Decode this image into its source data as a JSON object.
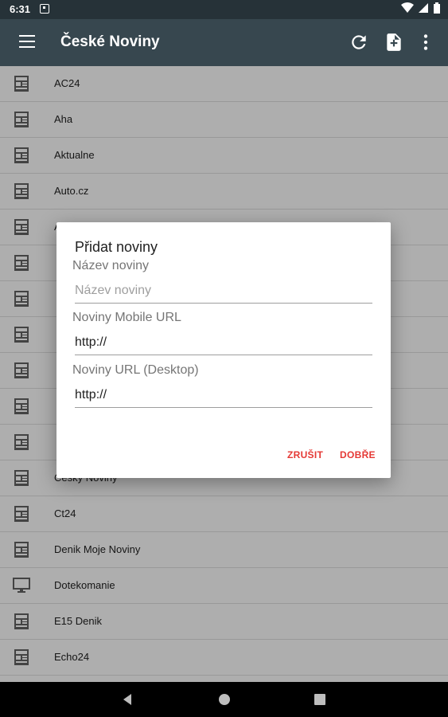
{
  "status_bar": {
    "time": "6:31"
  },
  "app_bar": {
    "title": "České Noviny"
  },
  "list_items": [
    {
      "label": "AC24",
      "icon": "newspaper-icon"
    },
    {
      "label": "Aha",
      "icon": "newspaper-icon"
    },
    {
      "label": "Aktualne",
      "icon": "newspaper-icon"
    },
    {
      "label": "Auto.cz",
      "icon": "newspaper-icon"
    },
    {
      "label": "A",
      "icon": "newspaper-icon"
    },
    {
      "label": "",
      "icon": "newspaper-icon"
    },
    {
      "label": "",
      "icon": "newspaper-icon"
    },
    {
      "label": "",
      "icon": "newspaper-icon"
    },
    {
      "label": "",
      "icon": "newspaper-icon"
    },
    {
      "label": "",
      "icon": "newspaper-icon"
    },
    {
      "label": "",
      "icon": "newspaper-icon"
    },
    {
      "label": "Ceský Noviny",
      "icon": "newspaper-icon"
    },
    {
      "label": "Ct24",
      "icon": "newspaper-icon"
    },
    {
      "label": "Denik Moje Noviny",
      "icon": "newspaper-icon"
    },
    {
      "label": "Dotekomanie",
      "icon": "monitor-icon"
    },
    {
      "label": "E15 Denik",
      "icon": "newspaper-icon"
    },
    {
      "label": "Echo24",
      "icon": "newspaper-icon"
    }
  ],
  "dialog": {
    "title": "Přidat noviny",
    "name_label": "Název noviny",
    "name_placeholder": "Název noviny",
    "name_value": "",
    "mobile_label": "Noviny Mobile URL",
    "mobile_value": "http://",
    "desktop_label": "Noviny URL (Desktop)",
    "desktop_value": "http://",
    "cancel_label": "ZRUŠIT",
    "ok_label": "DOBŘE"
  },
  "colors": {
    "app_bar": "#37474f",
    "status_bar": "#263238",
    "accent": "#e53935"
  }
}
